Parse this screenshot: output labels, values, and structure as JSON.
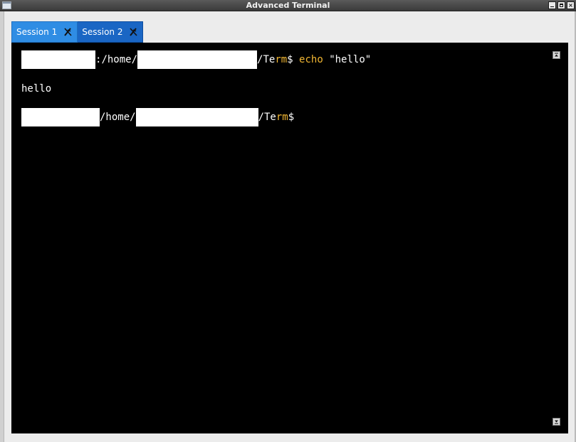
{
  "window": {
    "title": "Advanced Terminal",
    "controls": [
      "minimize",
      "maximize",
      "close"
    ]
  },
  "tabs": [
    {
      "label": "Session 1",
      "active": true
    },
    {
      "label": "Session 2",
      "active": false
    }
  ],
  "terminal": {
    "lines": [
      {
        "prompt_sep": ":",
        "path_prefix": "/home/",
        "path_suffix_a": "/Te",
        "path_suffix_b": "rm",
        "prompt_char": "$",
        "command": " echo ",
        "argument": "\"hello\""
      },
      {
        "output": "hello"
      },
      {
        "path_prefix": "/home/",
        "path_suffix_a": "/Te",
        "path_suffix_b": "rm",
        "prompt_char": "$"
      }
    ]
  },
  "colors": {
    "terminal_bg": "#000000",
    "text": "#ffffff",
    "highlight": "#f2b733",
    "tab_active": "#2f8de4",
    "tab_inactive": "#1a66c4"
  }
}
